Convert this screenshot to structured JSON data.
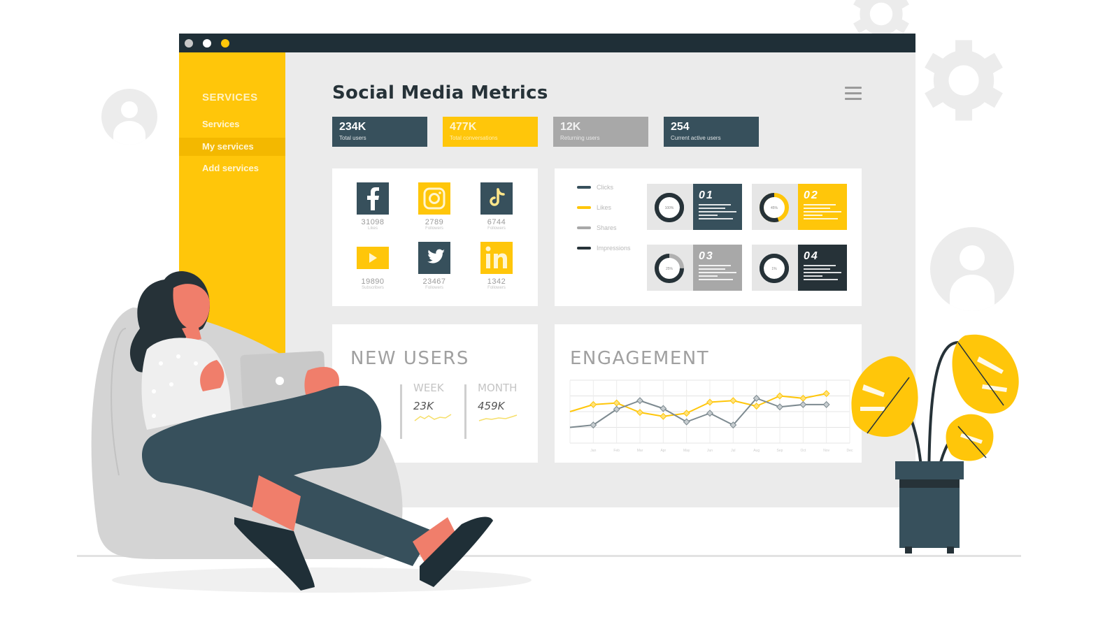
{
  "window": {
    "title_dots": [
      "#c8c8c8",
      "#ffffff",
      "#ffc60a"
    ]
  },
  "sidebar": {
    "title": "SERVICES",
    "items": [
      {
        "label": "Services",
        "active": false
      },
      {
        "label": "My services",
        "active": true
      },
      {
        "label": "Add services",
        "active": false
      }
    ]
  },
  "header": {
    "title": "Social Media Metrics",
    "menu_icon": "hamburger-menu-icon"
  },
  "stats": [
    {
      "value": "234K",
      "label": "Total users",
      "color": "#37505c",
      "text": "#ffffff"
    },
    {
      "value": "477K",
      "label": "Total conversations",
      "color": "#ffc60a",
      "text": "#fff5cf"
    },
    {
      "value": "12K",
      "label": "Returning users",
      "color": "#a8a8a8",
      "text": "#f2f2f2"
    },
    {
      "value": "254",
      "label": "Current active users",
      "color": "#37505c",
      "text": "#ffffff"
    }
  ],
  "social": [
    {
      "network": "Facebook",
      "icon": "facebook-icon",
      "count": "31098",
      "label": "Likes",
      "color": "#37505c"
    },
    {
      "network": "Instagram",
      "icon": "instagram-icon",
      "count": "2789",
      "label": "Followers",
      "color": "#ffc60a"
    },
    {
      "network": "TikTok",
      "icon": "tiktok-icon",
      "count": "6744",
      "label": "Followers",
      "color": "#37505c"
    },
    {
      "network": "YouTube",
      "icon": "youtube-icon",
      "count": "19890",
      "label": "Subscribers",
      "color": "#ffc60a"
    },
    {
      "network": "Twitter",
      "icon": "twitter-icon",
      "count": "23467",
      "label": "Followers",
      "color": "#37505c"
    },
    {
      "network": "LinkedIn",
      "icon": "linkedin-icon",
      "count": "1342",
      "label": "Followers",
      "color": "#ffc60a"
    }
  ],
  "legend": [
    {
      "label": "Clicks",
      "color": "#37505c"
    },
    {
      "label": "Likes",
      "color": "#ffc60a"
    },
    {
      "label": "Shares",
      "color": "#a8a8a8"
    },
    {
      "label": "Impressions",
      "color": "#263238"
    }
  ],
  "metrics": [
    {
      "number": "01",
      "percent": 100,
      "percent_label": "100%",
      "ring_color": "#263238",
      "rest_color": "#263238",
      "panel_color": "#37505c"
    },
    {
      "number": "02",
      "percent": 55,
      "percent_label": "45%",
      "ring_color": "#263238",
      "rest_color": "#ffc60a",
      "panel_color": "#ffc60a"
    },
    {
      "number": "03",
      "percent": 75,
      "percent_label": "25%",
      "ring_color": "#263238",
      "rest_color": "#b0b0b0",
      "panel_color": "#a8a8a8"
    },
    {
      "number": "04",
      "percent": 100,
      "percent_label": "1%",
      "ring_color": "#263238",
      "rest_color": "#263238",
      "panel_color": "#263238"
    }
  ],
  "new_users": {
    "title": "NEW USERS",
    "columns": [
      {
        "heading": "WEEK",
        "value": "23K"
      },
      {
        "heading": "MONTH",
        "value": "459K"
      }
    ]
  },
  "engagement": {
    "title": "ENGAGEMENT"
  },
  "chart_data": {
    "type": "line",
    "title": "ENGAGEMENT",
    "xlabel": "",
    "ylabel": "",
    "x": [
      "Jan",
      "Feb",
      "Mar",
      "Apr",
      "May",
      "Jun",
      "Jul",
      "Aug",
      "Sep",
      "Oct",
      "Nov",
      "Dec"
    ],
    "ylim": [
      0,
      4
    ],
    "grid": true,
    "series": [
      {
        "name": "Likes",
        "color": "#ffc60a",
        "start": 2.0,
        "values": [
          2.45,
          2.55,
          1.95,
          1.7,
          1.9,
          2.6,
          2.7,
          2.35,
          3.0,
          2.85,
          3.15
        ]
      },
      {
        "name": "Clicks",
        "color": "#7d8a90",
        "start": 1.0,
        "values": [
          1.15,
          2.15,
          2.7,
          2.2,
          1.35,
          1.9,
          1.15,
          2.85,
          2.3,
          2.45,
          2.45
        ]
      }
    ]
  }
}
